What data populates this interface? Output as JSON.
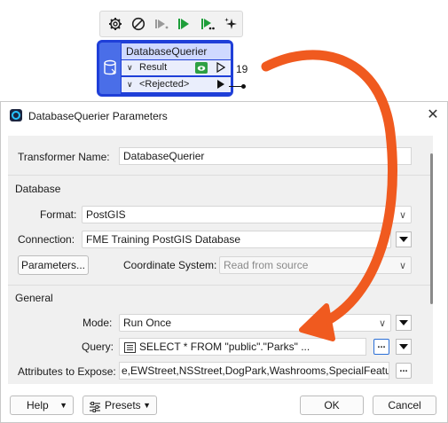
{
  "canvas": {
    "toolbar": {
      "icons": [
        "gear-icon",
        "disable-icon",
        "run-disabled-icon",
        "run-to-this-icon",
        "run-from-this-icon",
        "sparkle-icon"
      ]
    },
    "node": {
      "title": "DatabaseQuerier",
      "ports": [
        {
          "label": "Result",
          "count": "19"
        },
        {
          "label": "<Rejected>"
        }
      ]
    }
  },
  "dialog": {
    "title": "DatabaseQuerier Parameters",
    "transformer_name_label": "Transformer Name:",
    "transformer_name_value": "DatabaseQuerier",
    "database": {
      "section": "Database",
      "format_label": "Format:",
      "format_value": "PostGIS",
      "connection_label": "Connection:",
      "connection_value": "FME Training PostGIS Database",
      "parameters_button": "Parameters...",
      "coordsys_label": "Coordinate System:",
      "coordsys_value": "Read from source"
    },
    "general": {
      "section": "General",
      "mode_label": "Mode:",
      "mode_value": "Run Once",
      "query_label": "Query:",
      "query_value": "SELECT * FROM \"public\".\"Parks\" ...",
      "attrs_label": "Attributes to Expose:",
      "attrs_value": "e,EWStreet,NSStreet,DogPark,Washrooms,SpecialFeatures",
      "ellipsis": "..."
    },
    "footer": {
      "help": "Help",
      "presets": "Presets",
      "ok": "OK",
      "cancel": "Cancel"
    }
  },
  "colors": {
    "node_border": "#1f3fd8",
    "node_title_bg": "#cfd9ff",
    "annotation_arrow": "#f05a1f",
    "run_green": "#1e9e3a"
  }
}
